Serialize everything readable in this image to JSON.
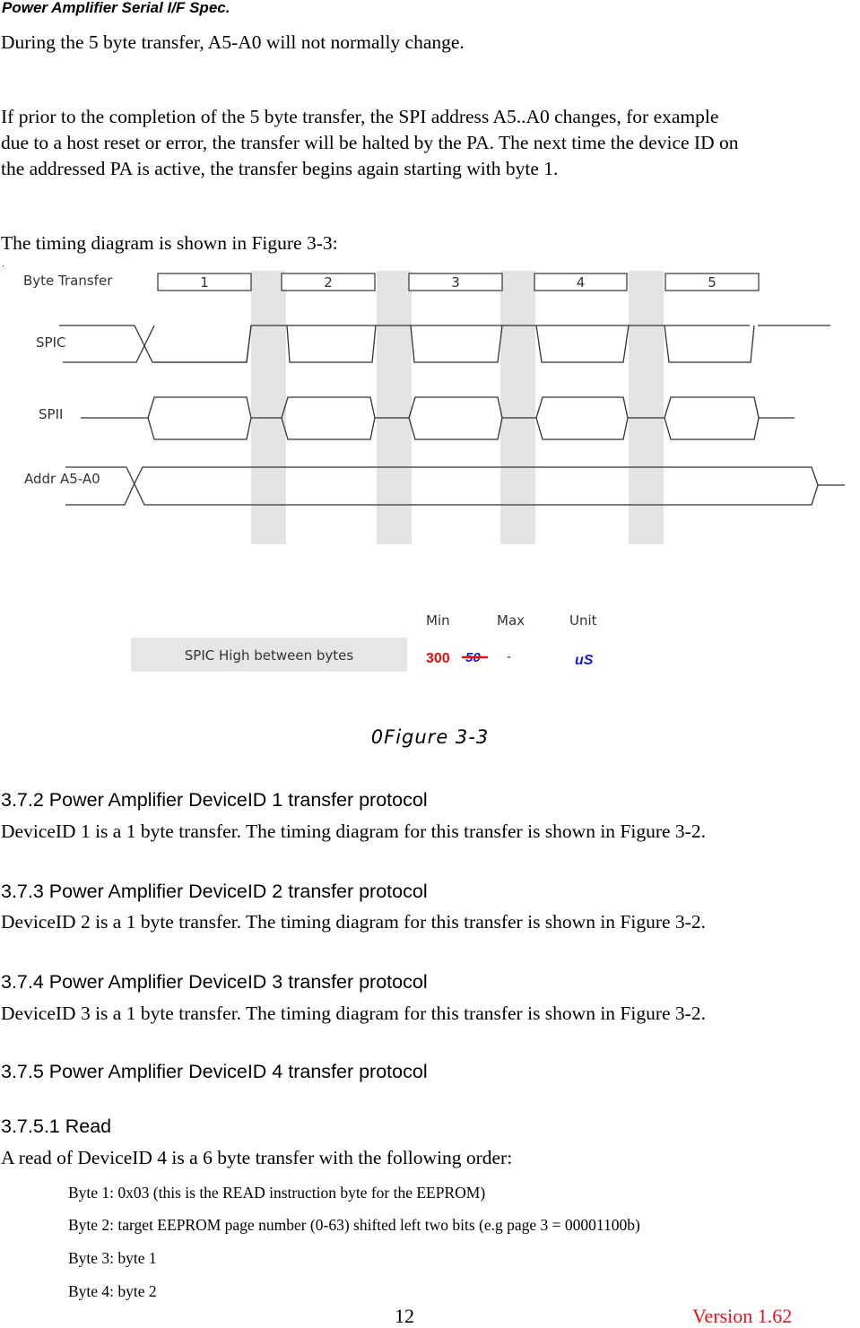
{
  "header": {
    "title": "Power Amplifier Serial I/F Spec."
  },
  "paragraphs": [
    "During the 5 byte transfer, A5-A0 will not normally change.",
    "If prior to the completion of the 5 byte transfer, the SPI address A5..A0 changes, for example",
    "due to a host reset or error, the transfer will be halted by the PA. The next time the device ID on",
    "the addressed PA is active, the transfer begins again starting with byte 1.",
    "The timing diagram is shown in Figure 3-3:"
  ],
  "diagram": {
    "signals": [
      "Byte Transfer",
      "SPIC",
      "SPII",
      "Addr A5-A0"
    ],
    "byte_boxes": [
      "1",
      "2",
      "3",
      "4",
      "5"
    ],
    "timing_table": {
      "headers": {
        "min": "Min",
        "max": "Max",
        "unit": "Unit"
      },
      "row_label": "SPIC High  between bytes",
      "min_value": "300",
      "min_struck_value": "50",
      "max_value": "-",
      "unit_value": "uS"
    },
    "colors": {
      "gap_shade": "#e4e4e4",
      "line": "#333333",
      "min_red": "#e01010",
      "unit_blue": "#1a1ad0",
      "label_bg": "#e6e6e6"
    }
  },
  "caption": "0Figure 3-3",
  "sections": [
    {
      "heading": "3.7.2  Power Amplifier DeviceID 1 transfer protocol",
      "text": "DeviceID 1 is a 1 byte transfer. The timing diagram for this transfer is shown in Figure 3-2."
    },
    {
      "heading": "3.7.3  Power Amplifier DeviceID 2 transfer protocol",
      "text": "DeviceID 2 is a 1 byte transfer. The timing diagram for this transfer is shown in Figure 3-2."
    },
    {
      "heading": "3.7.4  Power Amplifier DeviceID 3 transfer protocol",
      "text": "DeviceID 3 is a 1 byte transfer. The timing diagram for this transfer is shown in Figure 3-2."
    },
    {
      "heading": "3.7.5  Power Amplifier DeviceID 4 transfer protocol"
    }
  ],
  "subsection": {
    "heading": "3.7.5.1  Read",
    "intro": "A read of DeviceID 4 is a 6 byte transfer with the following order:",
    "items": [
      "Byte 1:   0x03  (this is the READ instruction byte for the EEPROM)",
      "Byte 2: target EEPROM page number (0-63) shifted left two bits (e.g page 3 = 00001100b)",
      "Byte 3: byte 1",
      "Byte 4: byte 2"
    ]
  },
  "footer": {
    "page_number": "12",
    "version": "Version 1.62"
  }
}
